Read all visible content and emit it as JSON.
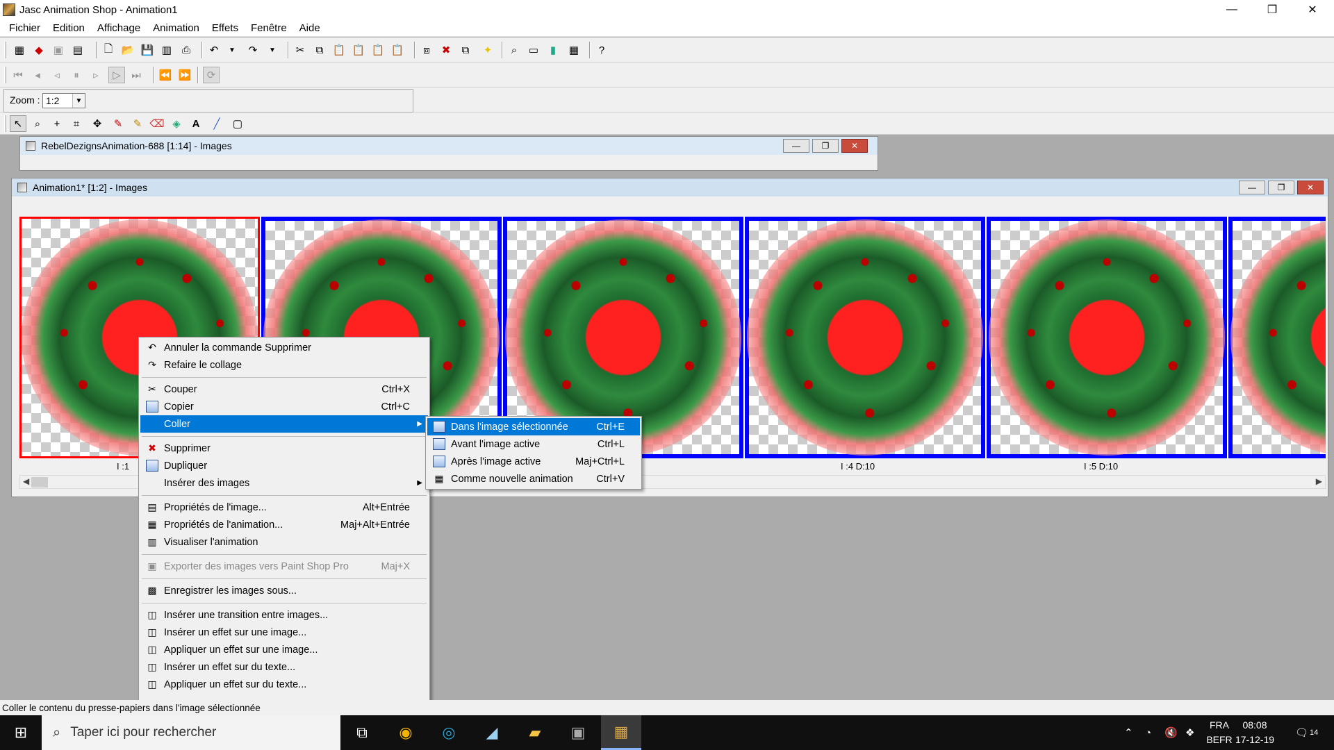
{
  "window": {
    "title": "Jasc Animation Shop - Animation1",
    "minimize": "—",
    "restore": "❐",
    "close": "✕"
  },
  "menubar": [
    "Fichier",
    "Edition",
    "Affichage",
    "Animation",
    "Effets",
    "Fenêtre",
    "Aide"
  ],
  "zoom": {
    "label": "Zoom :",
    "value": "1:2"
  },
  "windows": [
    {
      "title": "RebelDezignsAnimation-688 [1:14] - Images"
    },
    {
      "title": "Animation1* [1:2] - Images"
    }
  ],
  "frames": [
    {
      "label": "I :1"
    },
    {
      "label": ""
    },
    {
      "label": ""
    },
    {
      "label": "I :4  D:10"
    },
    {
      "label": "I :5  D:10"
    },
    {
      "label": ""
    }
  ],
  "context_menu": {
    "items": [
      {
        "label": "Annuler la commande Supprimer",
        "shortcut": "",
        "icon": "undo-icon"
      },
      {
        "label": "Refaire le collage",
        "shortcut": "",
        "icon": "redo-icon"
      },
      {
        "label": "Couper",
        "shortcut": "Ctrl+X",
        "icon": "scissors-icon"
      },
      {
        "label": "Copier",
        "shortcut": "Ctrl+C",
        "icon": "copy-icon"
      },
      {
        "label": "Coller",
        "shortcut": "",
        "icon": "paste-icon",
        "highlighted": true,
        "submenu": true
      },
      {
        "label": "Supprimer",
        "shortcut": "",
        "icon": "delete-icon"
      },
      {
        "label": "Dupliquer",
        "shortcut": "",
        "icon": "duplicate-icon"
      },
      {
        "label": "Insérer des images",
        "shortcut": "",
        "icon": "",
        "submenu": true
      },
      {
        "label": "Propriétés de l'image...",
        "shortcut": "Alt+Entrée",
        "icon": "frame-properties-icon"
      },
      {
        "label": "Propriétés de l'animation...",
        "shortcut": "Maj+Alt+Entrée",
        "icon": "animation-properties-icon"
      },
      {
        "label": "Visualiser l'animation",
        "shortcut": "",
        "icon": "view-animation-icon"
      },
      {
        "label": "Exporter des images vers Paint Shop Pro",
        "shortcut": "Maj+X",
        "icon": "export-icon",
        "disabled": true
      },
      {
        "label": "Enregistrer les images sous...",
        "shortcut": "",
        "icon": "save-frames-icon"
      },
      {
        "label": "Insérer une transition entre images...",
        "shortcut": "",
        "icon": "transition-icon"
      },
      {
        "label": "Insérer un effet sur une image...",
        "shortcut": "",
        "icon": "insert-effect-icon"
      },
      {
        "label": "Appliquer un effet sur une image...",
        "shortcut": "",
        "icon": "apply-effect-icon"
      },
      {
        "label": "Insérer un effet sur du texte...",
        "shortcut": "",
        "icon": "insert-text-effect-icon"
      },
      {
        "label": "Appliquer un effet sur du texte...",
        "shortcut": "",
        "icon": "apply-text-effect-icon"
      }
    ]
  },
  "submenu": {
    "items": [
      {
        "label": "Dans l'image sélectionnée",
        "shortcut": "Ctrl+E",
        "highlighted": true
      },
      {
        "label": "Avant l'image active",
        "shortcut": "Ctrl+L"
      },
      {
        "label": "Après l'image active",
        "shortcut": "Maj+Ctrl+L"
      },
      {
        "label": "Comme nouvelle animation",
        "shortcut": "Ctrl+V"
      }
    ]
  },
  "statusbar": {
    "text": "Coller le contenu du presse-papiers dans l'image sélectionnée"
  },
  "taskbar": {
    "search_placeholder": "Taper ici pour rechercher",
    "lang_top": "FRA",
    "lang_bottom": "BEFR",
    "time": "08:08",
    "date": "17-12-19",
    "notifications": "14"
  },
  "colors": {
    "selection": "#0078d7",
    "frame_border": "#0000ff",
    "active_frame_border": "#ff0000"
  }
}
